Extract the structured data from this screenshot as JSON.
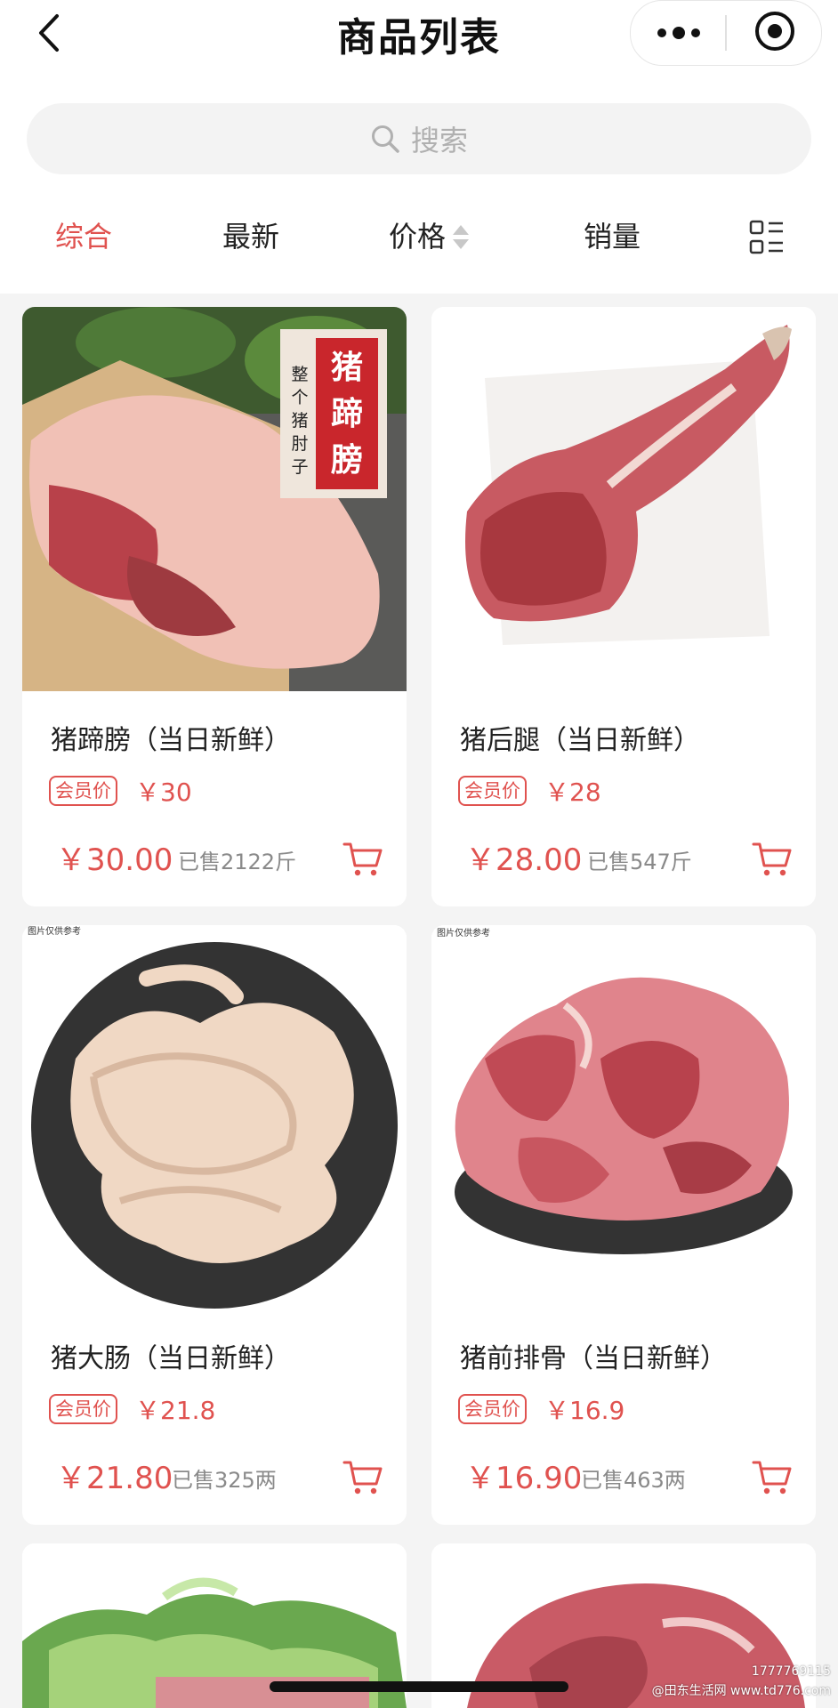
{
  "header": {
    "title": "商品列表"
  },
  "search": {
    "placeholder": "搜索"
  },
  "filters": [
    {
      "label": "综合",
      "active": true
    },
    {
      "label": "最新",
      "active": false
    },
    {
      "label": "价格",
      "active": false
    },
    {
      "label": "销量",
      "active": false
    }
  ],
  "products": [
    {
      "name": "猪蹄膀（当日新鲜）",
      "member_badge": "会员价",
      "member_price": "￥30",
      "price": "￥30.00",
      "sold": "已售2122斤",
      "image_text_main": "猪蹄膀",
      "image_text_side": "整个猪肘子"
    },
    {
      "name": "猪后腿（当日新鲜）",
      "member_badge": "会员价",
      "member_price": "￥28",
      "price": "￥28.00",
      "sold": "已售547斤"
    },
    {
      "name": "猪大肠（当日新鲜）",
      "member_badge": "会员价",
      "member_price": "￥21.8",
      "price": "￥21.80",
      "sold": "已售325两",
      "image_caption": "图片仅供参考"
    },
    {
      "name": "猪前排骨（当日新鲜）",
      "member_badge": "会员价",
      "member_price": "￥16.9",
      "price": "￥16.90",
      "sold": "已售463两",
      "image_caption": "图片仅供参考"
    }
  ],
  "watermark": {
    "line1": "1777769115",
    "line2": "@田东生活网 www.td776.com"
  },
  "colors": {
    "accent": "#e0524f",
    "background": "#f4f4f4"
  }
}
